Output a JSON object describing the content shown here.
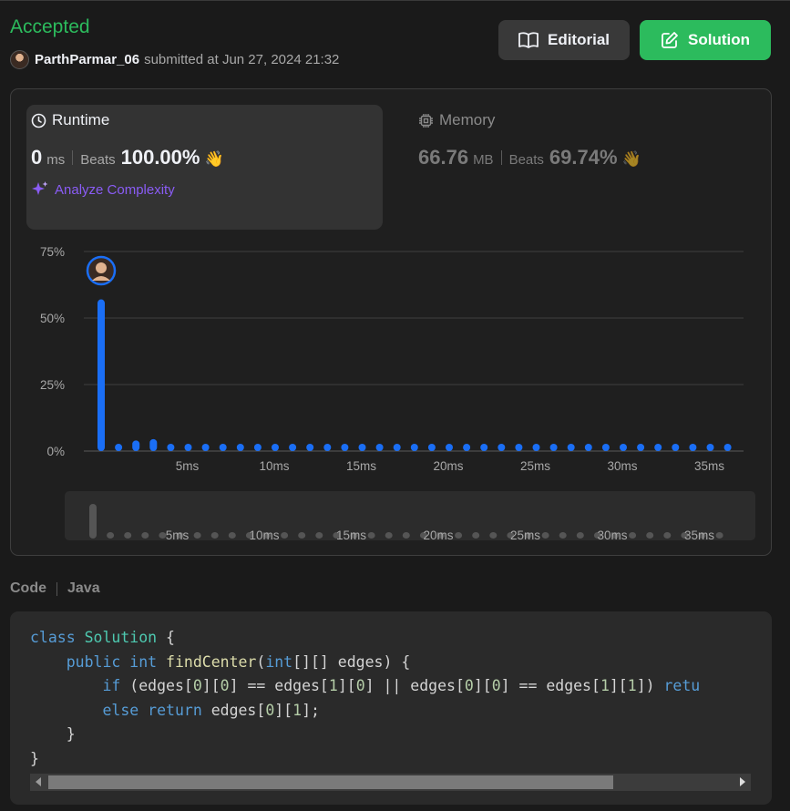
{
  "header": {
    "status": "Accepted",
    "username": "ParthParmar_06",
    "submitted_text": "submitted at Jun 27, 2024 21:32",
    "editorial_label": "Editorial",
    "solution_label": "Solution"
  },
  "runtime": {
    "title": "Runtime",
    "value": "0",
    "unit": "ms",
    "beats_label": "Beats",
    "beats_value": "100.00%",
    "analyze_label": "Analyze Complexity"
  },
  "memory": {
    "title": "Memory",
    "value": "66.76",
    "unit": "MB",
    "beats_label": "Beats",
    "beats_value": "69.74%"
  },
  "chart_data": {
    "type": "bar",
    "ylim": [
      0,
      75
    ],
    "yticks": [
      "0%",
      "25%",
      "50%",
      "75%"
    ],
    "xticks": [
      "5ms",
      "10ms",
      "15ms",
      "20ms",
      "25ms",
      "30ms",
      "35ms"
    ],
    "x": [
      0,
      1,
      2,
      3,
      4,
      5,
      6,
      7,
      8,
      9,
      10,
      11,
      12,
      13,
      14,
      15,
      16,
      17,
      18,
      19,
      20,
      21,
      22,
      23,
      24,
      25,
      26,
      27,
      28,
      29,
      30,
      31,
      32,
      33,
      34,
      35,
      36
    ],
    "values": [
      57,
      1.5,
      4,
      4.5,
      1.5,
      1.5,
      1.5,
      1.5,
      1.5,
      1.5,
      1.5,
      1.5,
      1.5,
      1.5,
      1.5,
      1.5,
      1.5,
      1.5,
      1.5,
      1.5,
      1.5,
      1.5,
      1.5,
      1.5,
      1.5,
      1.5,
      1.5,
      1.5,
      1.5,
      1.5,
      1.5,
      1.5,
      1.5,
      1.5,
      1.5,
      1.5,
      1.5
    ],
    "highlight_index": 0,
    "grid": true
  },
  "code": {
    "label": "Code",
    "language": "Java",
    "lines": [
      [
        [
          "kw",
          "class "
        ],
        [
          "cls",
          "Solution"
        ],
        [
          "",
          " {"
        ]
      ],
      [
        [
          "",
          "    "
        ],
        [
          "kw",
          "public int "
        ],
        [
          "fn",
          "findCenter"
        ],
        [
          "",
          "("
        ],
        [
          "kw",
          "int"
        ],
        [
          "",
          "[][] edges) {"
        ]
      ],
      [
        [
          "",
          "        "
        ],
        [
          "kw",
          "if"
        ],
        [
          "",
          " (edges["
        ],
        [
          "num",
          "0"
        ],
        [
          "",
          "]["
        ],
        [
          "num",
          "0"
        ],
        [
          "",
          "] == edges["
        ],
        [
          "num",
          "1"
        ],
        [
          "",
          "]["
        ],
        [
          "num",
          "0"
        ],
        [
          "",
          "] || edges["
        ],
        [
          "num",
          "0"
        ],
        [
          "",
          "]["
        ],
        [
          "num",
          "0"
        ],
        [
          "",
          "] == edges["
        ],
        [
          "num",
          "1"
        ],
        [
          "",
          "]["
        ],
        [
          "num",
          "1"
        ],
        [
          "",
          "]) "
        ],
        [
          "kw",
          "retu"
        ]
      ],
      [
        [
          "",
          "        "
        ],
        [
          "kw",
          "else return"
        ],
        [
          "",
          " edges["
        ],
        [
          "num",
          "0"
        ],
        [
          "",
          "]["
        ],
        [
          "num",
          "1"
        ],
        [
          "",
          "];"
        ]
      ],
      [
        [
          "",
          "    }"
        ]
      ],
      [
        [
          "",
          "}"
        ]
      ]
    ]
  }
}
